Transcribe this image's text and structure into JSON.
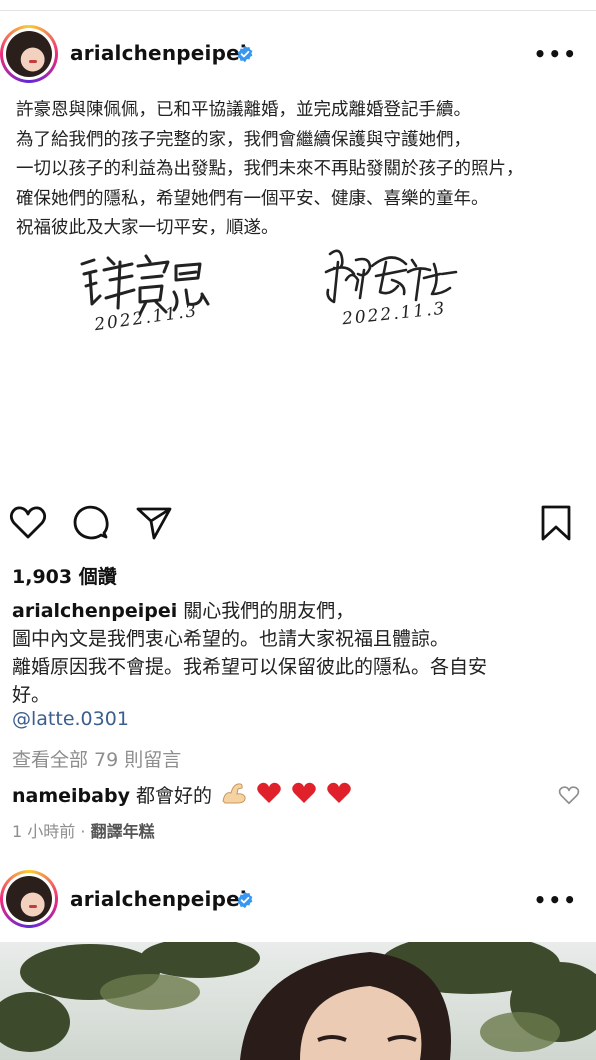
{
  "post1": {
    "username": "arialchenpeipei",
    "more_label": "•••",
    "statement_lines": [
      "許豪恩與陳佩佩，已和平協議離婚，並完成離婚登記手續。",
      "為了給我們的孩子完整的家，我們會繼續保護與守護她們，",
      "一切以孩子的利益為出發點，我們未來不再貼發關於孩子的照片，",
      "確保她們的隱私，希望她們有一個平安、健康、喜樂的童年。",
      "祝福彼此及大家一切平安，順遂。"
    ],
    "signature_left": {
      "name": "許豪恩",
      "date": "2022.11.3"
    },
    "signature_right": {
      "name": "陳佩佩",
      "date": "2022.11.3"
    },
    "likes": "1,903 個讚",
    "caption_user": "arialchenpeipei",
    "caption_lines": [
      "關心我們的朋友們，",
      "圖中內文是我們衷心希望的。也請大家祝福且體諒。",
      "離婚原因我不會提。我希望可以保留彼此的隱私。各自安",
      "好。"
    ],
    "mention": "@latte.0301",
    "view_all_comments": "查看全部 79 則留言",
    "comment": {
      "user": "nameibaby",
      "text": "都會好的"
    },
    "comment_time": "1 小時前",
    "comment_dot": "·",
    "translate_label": "翻譯年糕",
    "icons": [
      "heart-icon",
      "comment-icon",
      "share-icon",
      "bookmark-icon",
      "verified-badge-icon",
      "flexed-biceps-emoji",
      "red-heart-emoji"
    ],
    "colors": {
      "verified_blue": "#3897f0",
      "mention_blue": "#3b5f8c",
      "muted": "#8e8e8e",
      "heart_red": "#e0202a"
    }
  },
  "post2": {
    "username": "arialchenpeipei",
    "more_label": "•••"
  }
}
